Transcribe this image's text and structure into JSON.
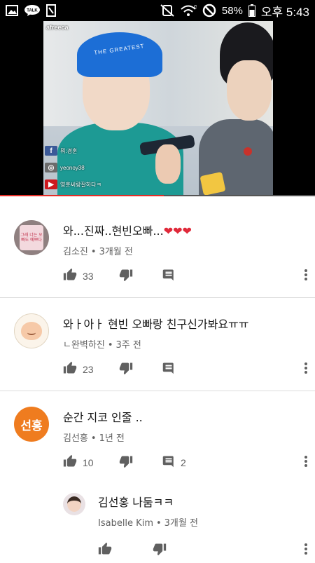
{
  "status_bar": {
    "battery_percent": "58%",
    "time": "오후 5:43",
    "network": "G",
    "icons": [
      "image-icon",
      "talk-icon",
      "document-icon",
      "mute-icon",
      "wifi-icon",
      "do-not-disturb-icon",
      "battery-icon"
    ]
  },
  "video": {
    "channel_label": "afreeca",
    "cap_text": "THE GREATEST",
    "social": [
      {
        "icon": "facebook-icon",
        "text": "뭐:경훈"
      },
      {
        "icon": "instagram-icon",
        "text": "yeonoy38"
      },
      {
        "icon": "youtube-icon",
        "text": "영훈씨랑잘하다ㅋ"
      }
    ],
    "progress_fraction": 0.52
  },
  "comments": [
    {
      "text": "와...진짜..현빈오빠...❤❤❤",
      "author": "김소진",
      "time": "3개월 전",
      "likes": "33",
      "replies": "",
      "avatar_text": "그래 너는 오빠도 예쁘다"
    },
    {
      "text": "와ㅏ아ㅏ 현빈 오빠랑 친구신가봐요ㅠㅠ",
      "author": "ㄴ완벽하진",
      "time": "3주 전",
      "likes": "23",
      "replies": ""
    },
    {
      "text": "순간 지코 인줄 ..",
      "author": "김선홍",
      "time": "1년 전",
      "likes": "10",
      "replies": "2",
      "avatar_text": "선홍"
    }
  ],
  "reply": {
    "text": "김선홍 나둠ㅋㅋ",
    "author": "Isabelle Kim",
    "time": "3개월 전"
  },
  "colors": {
    "accent_orange": "#ef7c1f",
    "progress_red": "#e52d27",
    "heart_red": "#e0293a",
    "icon_gray": "#606060"
  },
  "meta_separator": "•"
}
